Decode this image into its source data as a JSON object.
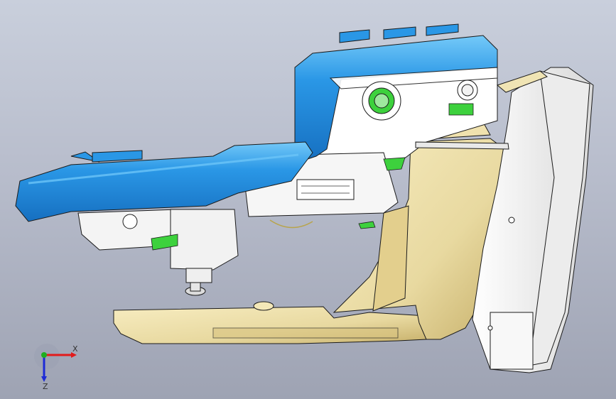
{
  "viewport": {
    "background_top": "#c9cfdc",
    "background_bottom": "#9ea3b3"
  },
  "parts": {
    "top_cover_color": "#2a97e6",
    "top_cover_highlight": "#6cc4f7",
    "base_bracket_color": "#e8d9a0",
    "base_bracket_shadow": "#c7b06a",
    "housing_color": "#f2f2f2",
    "accent_green": "#3dd13d",
    "edge_color": "#1b1b1b"
  },
  "triad": {
    "x_label": "X",
    "z_label": "Z",
    "x_color": "#e21b1b",
    "y_color": "#1fae1f",
    "z_color": "#1d2bd6"
  }
}
